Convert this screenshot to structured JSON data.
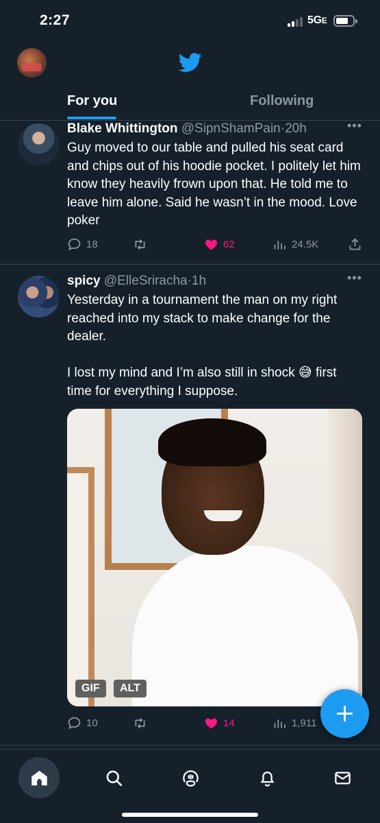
{
  "status_bar": {
    "time": "2:27",
    "network": "5G",
    "network_suffix": "E"
  },
  "header": {
    "logo_icon": "twitter-bird-icon",
    "tabs": [
      {
        "label": "For you",
        "active": true
      },
      {
        "label": "Following",
        "active": false
      }
    ],
    "accent_color": "#1d9bf0"
  },
  "tweets": [
    {
      "display_name": "Blake Whittington",
      "handle": "@SipnShamPain",
      "separator": "·",
      "time": "20h",
      "text": "Guy moved to our table and pulled his seat card and chips out of his hoodie pocket. I politely let him know they heavily frown upon that. He told me to leave him alone. Said he wasn’t in the mood. Love poker",
      "replies": "18",
      "retweets": "",
      "likes": "62",
      "liked": true,
      "views": "24.5K"
    },
    {
      "display_name": "spicy",
      "handle": "@ElleSriracha",
      "separator": "·",
      "time": "1h",
      "text": "Yesterday in a tournament the man on my right reached into my stack to make change for the dealer.\n\nI lost my mind and I’m also still in shock 😅 first time for everything I suppose.",
      "media": {
        "badges": [
          "GIF",
          "ALT"
        ]
      },
      "replies": "10",
      "retweets": "",
      "likes": "14",
      "liked": true,
      "views": "1,911"
    }
  ],
  "more_label": "•••",
  "fab_icon": "plus-icon",
  "bottom_nav": [
    "home-icon",
    "search-icon",
    "spaces-icon",
    "notifications-icon",
    "messages-icon"
  ],
  "colors": {
    "background": "#15202b",
    "like": "#f91880",
    "muted": "#8b98a5"
  }
}
